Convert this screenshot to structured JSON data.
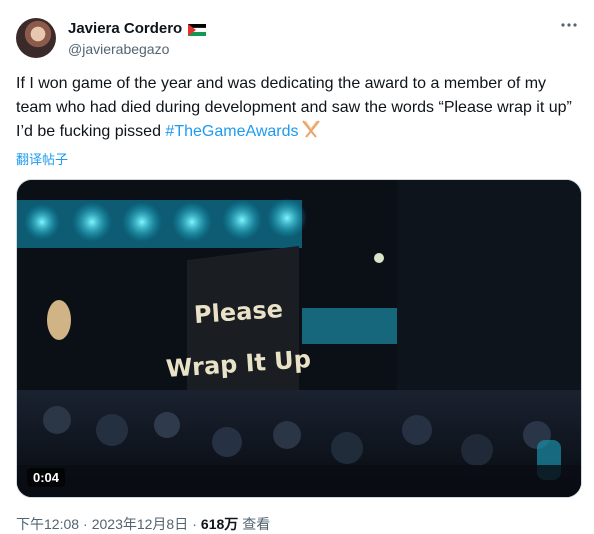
{
  "author": {
    "display_name": "Javiera Cordero",
    "handle": "@javierabegazo",
    "flag_icon": "palestine-flag-icon"
  },
  "menu_icon": "more-horizontal-icon",
  "tweet": {
    "text": "If I won game of the year and was dedicating the award to a member of my team who had died during development and saw the words “Please wrap it up” I’d be fucking pissed ",
    "hashtag": "#TheGameAwards",
    "hashtag_icon": "game-awards-icon",
    "translate_label": "翻译帖子"
  },
  "media": {
    "type": "video",
    "duration": "0:04",
    "sign_text_line1": "Please",
    "sign_text_line2": "Wrap It Up"
  },
  "meta": {
    "time": "下午12:08",
    "separator1": "·",
    "date": "2023年12月8日",
    "separator2": "·",
    "views_count": "618万",
    "views_label": "查看"
  },
  "colors": {
    "link": "#1d9bf0",
    "text": "#0f1419",
    "secondary": "#536471"
  }
}
